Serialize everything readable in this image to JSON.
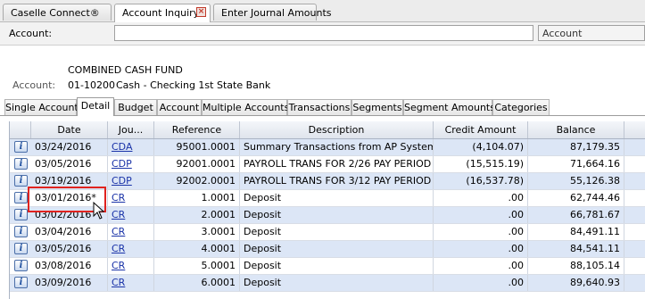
{
  "tabs": [
    {
      "label": "Caselle Connect®",
      "active": false
    },
    {
      "label": "Account Inquiry",
      "active": true,
      "closable": true
    },
    {
      "label": "Enter Journal Amounts",
      "active": false
    }
  ],
  "close_glyph": "×",
  "search": {
    "label": "Account:",
    "value": "",
    "field_type": "Account"
  },
  "account": {
    "fund_name": "COMBINED CASH FUND",
    "label": "Account:",
    "number": "01-10200",
    "description": "Cash - Checking 1st State Bank"
  },
  "subtabs": [
    "Single Account",
    "Detail",
    "Budget",
    "Account",
    "Multiple Accounts",
    "Transactions",
    "Segments",
    "Segment Amounts",
    "Categories"
  ],
  "active_subtab": "Detail",
  "grid": {
    "columns": [
      "Date",
      "Jou...",
      "Reference",
      "Description",
      "Credit Amount",
      "Balance"
    ],
    "info_glyph": "i",
    "rows": [
      {
        "date": "03/24/2016",
        "journal": "CDA",
        "reference": "95001.0001",
        "description": "Summary Transactions from AP System",
        "credit": "(4,104.07)",
        "balance": "87,179.35"
      },
      {
        "date": "03/05/2016",
        "journal": "CDP",
        "reference": "92001.0001",
        "description": "PAYROLL TRANS FOR 2/26 PAY PERIOD",
        "credit": "(15,515.19)",
        "balance": "71,664.16"
      },
      {
        "date": "03/19/2016",
        "journal": "CDP",
        "reference": "92002.0001",
        "description": "PAYROLL TRANS FOR 3/12 PAY PERIOD",
        "credit": "(16,537.78)",
        "balance": "55,126.38"
      },
      {
        "date": "03/01/2016*",
        "journal": "CR",
        "reference": "1.0001",
        "description": "Deposit",
        "credit": ".00",
        "balance": "62,744.46"
      },
      {
        "date": "03/02/2016",
        "journal": "CR",
        "reference": "2.0001",
        "description": "Deposit",
        "credit": ".00",
        "balance": "66,781.67"
      },
      {
        "date": "03/04/2016",
        "journal": "CR",
        "reference": "3.0001",
        "description": "Deposit",
        "credit": ".00",
        "balance": "84,491.11"
      },
      {
        "date": "03/05/2016",
        "journal": "CR",
        "reference": "4.0001",
        "description": "Deposit",
        "credit": ".00",
        "balance": "84,541.11"
      },
      {
        "date": "03/08/2016",
        "journal": "CR",
        "reference": "5.0001",
        "description": "Deposit",
        "credit": ".00",
        "balance": "88,105.14"
      },
      {
        "date": "03/09/2016",
        "journal": "CR",
        "reference": "6.0001",
        "description": "Deposit",
        "credit": ".00",
        "balance": "89,640.93"
      }
    ]
  },
  "colors": {
    "alt_row": "#dce6f6",
    "link": "#1a33a8",
    "highlight": "#e0231f"
  }
}
